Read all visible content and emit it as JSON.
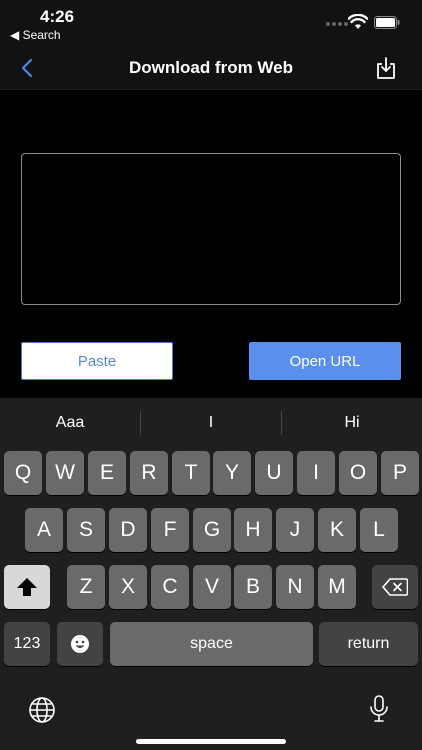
{
  "status_bar": {
    "time": "4:26",
    "back_app": "◀ Search"
  },
  "nav": {
    "title": "Download from Web"
  },
  "buttons": {
    "paste": "Paste",
    "open_url": "Open URL"
  },
  "keyboard": {
    "predictions": [
      "Aaa",
      "I",
      "Hi"
    ],
    "row1": [
      "Q",
      "W",
      "E",
      "R",
      "T",
      "Y",
      "U",
      "I",
      "O",
      "P"
    ],
    "row2": [
      "A",
      "S",
      "D",
      "F",
      "G",
      "H",
      "J",
      "K",
      "L"
    ],
    "row3": [
      "Z",
      "X",
      "C",
      "V",
      "B",
      "N",
      "M"
    ],
    "numbers_label": "123",
    "space_label": "space",
    "return_label": "return"
  },
  "colors": {
    "accent": "#5a8fed",
    "paste_text": "#5b86d8"
  }
}
